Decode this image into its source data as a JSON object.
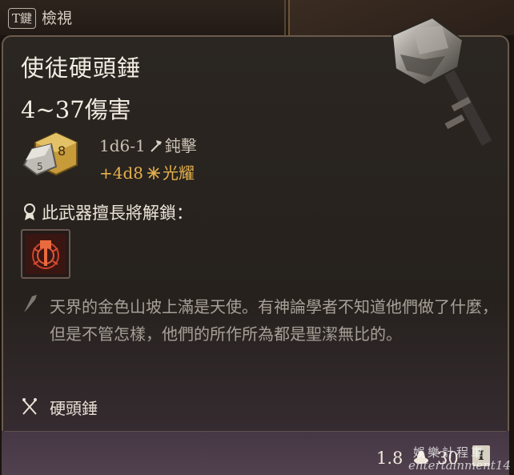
{
  "header": {
    "key_label": "T鍵",
    "inspect_label": "檢視"
  },
  "item": {
    "name": "使徒硬頭錘",
    "damage_total": "4~37傷害",
    "damage_rows": [
      {
        "dice": "1d6-1",
        "type": "鈍擊",
        "icon": "hammer-icon",
        "color": "#c9c0b3"
      },
      {
        "dice": "+4d8",
        "type": "光耀",
        "icon": "radiant-icon",
        "color": "#e4b04c"
      }
    ],
    "proficiency_unlock_label": "此武器擅長將解鎖：",
    "lore": "天界的金色山坡上滿是天使。有神論學者不知道他們做了什麼，但是不管怎樣，他們的所作所為都是聖潔無比的。",
    "weapon_type": "硬頭錘",
    "weight": "1.8",
    "price": "30",
    "rarity_badge": "I"
  },
  "watermark": {
    "top": "娛樂計程車",
    "bottom": "entertainment14"
  },
  "colors": {
    "panel_bg": "#28231f",
    "footer_bg": "#4b3d49",
    "radiant": "#e4b04c",
    "border": "#6b5a4c"
  }
}
